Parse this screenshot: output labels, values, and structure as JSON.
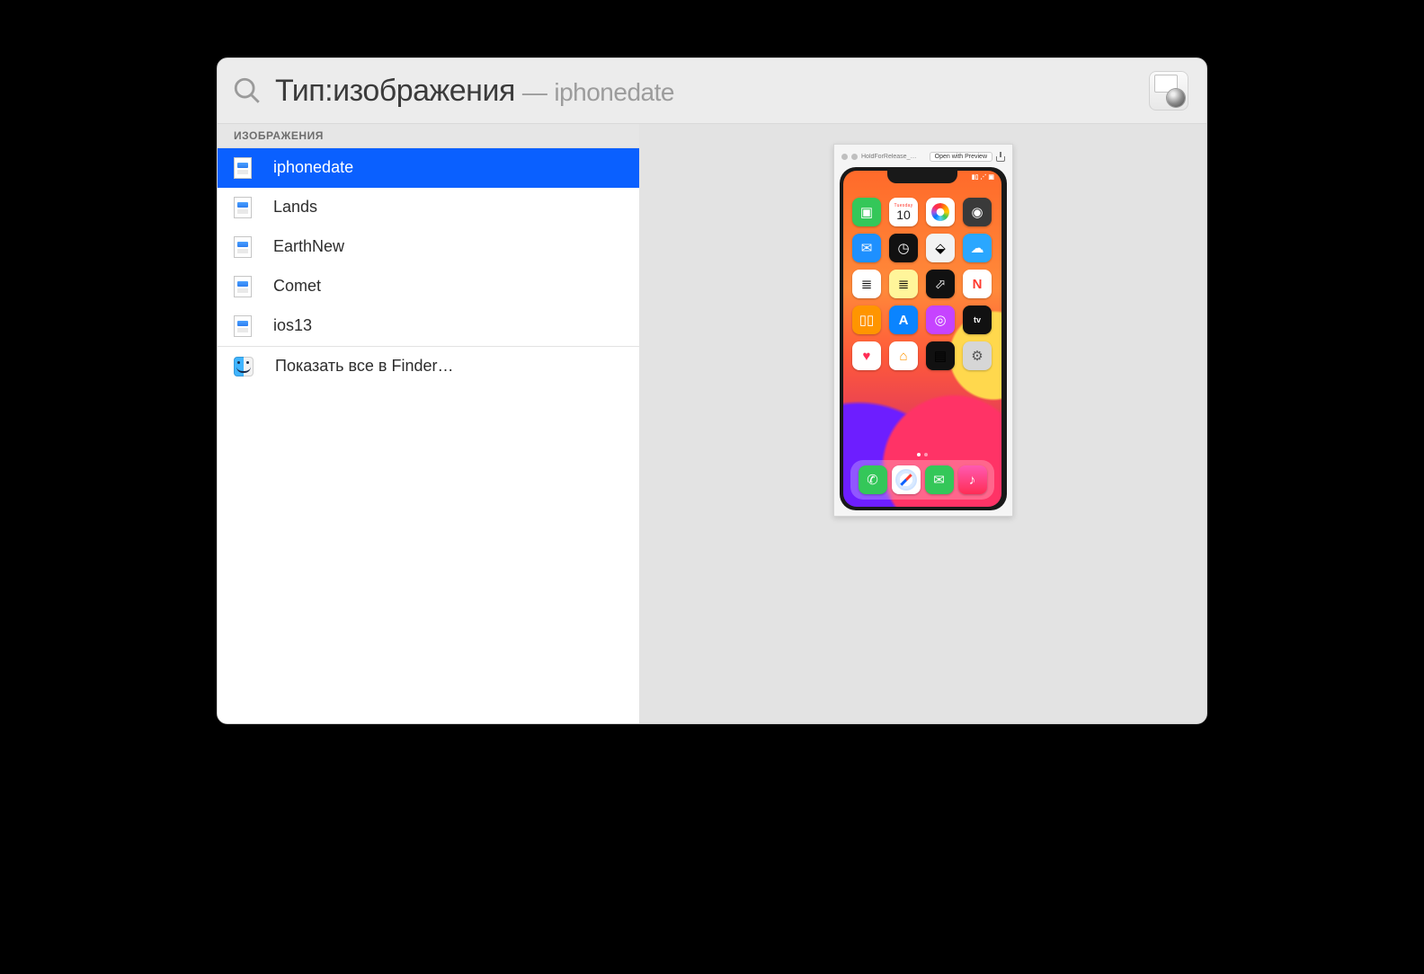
{
  "search": {
    "token_label": "Тип:изображения",
    "separator": "—",
    "term": "iphonedate"
  },
  "group_header": "ИЗОБРАЖЕНИЯ",
  "results": [
    {
      "name": "iphonedate",
      "selected": true
    },
    {
      "name": "Lands",
      "selected": false
    },
    {
      "name": "EarthNew",
      "selected": false
    },
    {
      "name": "Comet",
      "selected": false
    },
    {
      "name": "ios13",
      "selected": false
    }
  ],
  "show_all_label": "Показать все в Finder…",
  "preview": {
    "toolbar_title": "HoldForRelease_…",
    "open_button": "Open with Preview",
    "calendar": {
      "dow": "Tuesday",
      "day": "10"
    },
    "tv_label": "tv"
  }
}
